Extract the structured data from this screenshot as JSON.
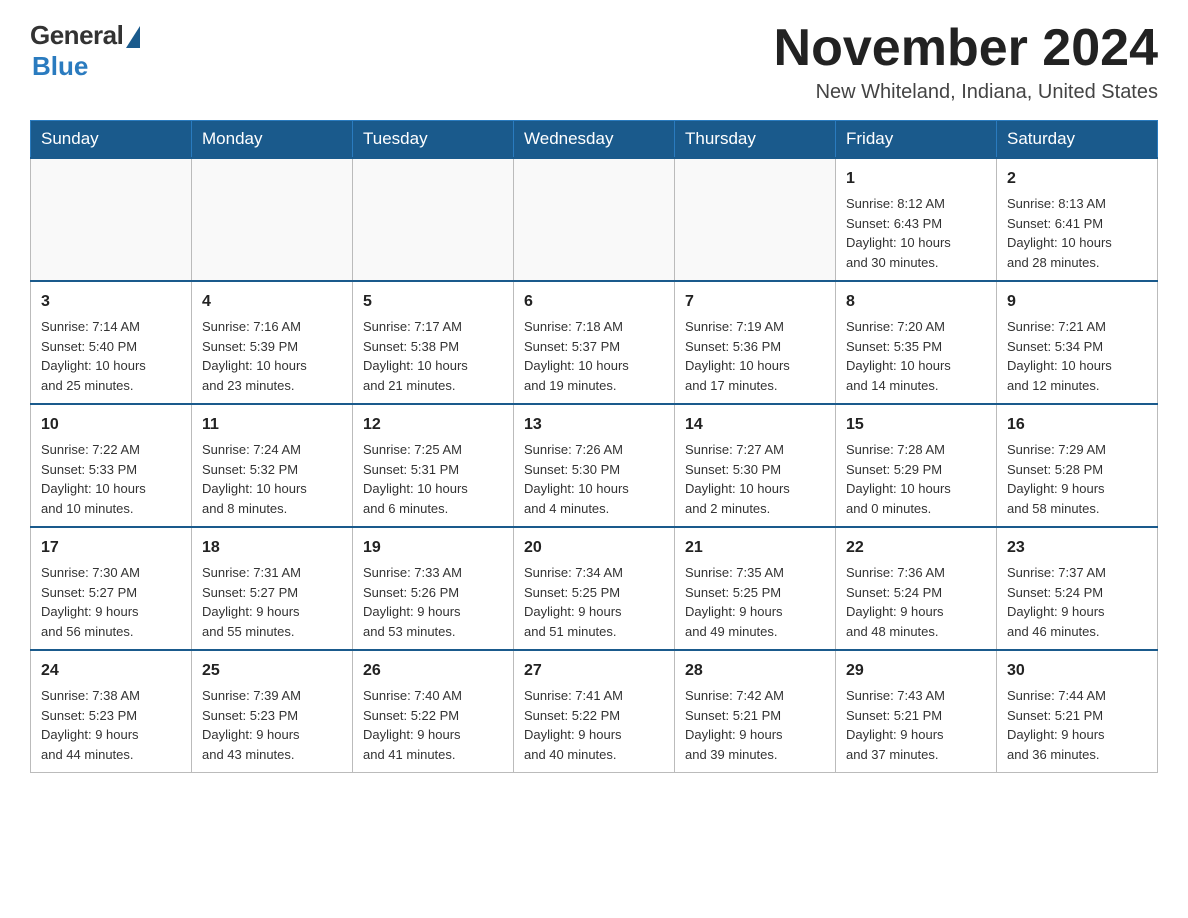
{
  "header": {
    "logo_general": "General",
    "logo_blue": "Blue",
    "month_title": "November 2024",
    "location": "New Whiteland, Indiana, United States"
  },
  "weekdays": [
    "Sunday",
    "Monday",
    "Tuesday",
    "Wednesday",
    "Thursday",
    "Friday",
    "Saturday"
  ],
  "weeks": [
    [
      {
        "day": "",
        "info": ""
      },
      {
        "day": "",
        "info": ""
      },
      {
        "day": "",
        "info": ""
      },
      {
        "day": "",
        "info": ""
      },
      {
        "day": "",
        "info": ""
      },
      {
        "day": "1",
        "info": "Sunrise: 8:12 AM\nSunset: 6:43 PM\nDaylight: 10 hours\nand 30 minutes."
      },
      {
        "day": "2",
        "info": "Sunrise: 8:13 AM\nSunset: 6:41 PM\nDaylight: 10 hours\nand 28 minutes."
      }
    ],
    [
      {
        "day": "3",
        "info": "Sunrise: 7:14 AM\nSunset: 5:40 PM\nDaylight: 10 hours\nand 25 minutes."
      },
      {
        "day": "4",
        "info": "Sunrise: 7:16 AM\nSunset: 5:39 PM\nDaylight: 10 hours\nand 23 minutes."
      },
      {
        "day": "5",
        "info": "Sunrise: 7:17 AM\nSunset: 5:38 PM\nDaylight: 10 hours\nand 21 minutes."
      },
      {
        "day": "6",
        "info": "Sunrise: 7:18 AM\nSunset: 5:37 PM\nDaylight: 10 hours\nand 19 minutes."
      },
      {
        "day": "7",
        "info": "Sunrise: 7:19 AM\nSunset: 5:36 PM\nDaylight: 10 hours\nand 17 minutes."
      },
      {
        "day": "8",
        "info": "Sunrise: 7:20 AM\nSunset: 5:35 PM\nDaylight: 10 hours\nand 14 minutes."
      },
      {
        "day": "9",
        "info": "Sunrise: 7:21 AM\nSunset: 5:34 PM\nDaylight: 10 hours\nand 12 minutes."
      }
    ],
    [
      {
        "day": "10",
        "info": "Sunrise: 7:22 AM\nSunset: 5:33 PM\nDaylight: 10 hours\nand 10 minutes."
      },
      {
        "day": "11",
        "info": "Sunrise: 7:24 AM\nSunset: 5:32 PM\nDaylight: 10 hours\nand 8 minutes."
      },
      {
        "day": "12",
        "info": "Sunrise: 7:25 AM\nSunset: 5:31 PM\nDaylight: 10 hours\nand 6 minutes."
      },
      {
        "day": "13",
        "info": "Sunrise: 7:26 AM\nSunset: 5:30 PM\nDaylight: 10 hours\nand 4 minutes."
      },
      {
        "day": "14",
        "info": "Sunrise: 7:27 AM\nSunset: 5:30 PM\nDaylight: 10 hours\nand 2 minutes."
      },
      {
        "day": "15",
        "info": "Sunrise: 7:28 AM\nSunset: 5:29 PM\nDaylight: 10 hours\nand 0 minutes."
      },
      {
        "day": "16",
        "info": "Sunrise: 7:29 AM\nSunset: 5:28 PM\nDaylight: 9 hours\nand 58 minutes."
      }
    ],
    [
      {
        "day": "17",
        "info": "Sunrise: 7:30 AM\nSunset: 5:27 PM\nDaylight: 9 hours\nand 56 minutes."
      },
      {
        "day": "18",
        "info": "Sunrise: 7:31 AM\nSunset: 5:27 PM\nDaylight: 9 hours\nand 55 minutes."
      },
      {
        "day": "19",
        "info": "Sunrise: 7:33 AM\nSunset: 5:26 PM\nDaylight: 9 hours\nand 53 minutes."
      },
      {
        "day": "20",
        "info": "Sunrise: 7:34 AM\nSunset: 5:25 PM\nDaylight: 9 hours\nand 51 minutes."
      },
      {
        "day": "21",
        "info": "Sunrise: 7:35 AM\nSunset: 5:25 PM\nDaylight: 9 hours\nand 49 minutes."
      },
      {
        "day": "22",
        "info": "Sunrise: 7:36 AM\nSunset: 5:24 PM\nDaylight: 9 hours\nand 48 minutes."
      },
      {
        "day": "23",
        "info": "Sunrise: 7:37 AM\nSunset: 5:24 PM\nDaylight: 9 hours\nand 46 minutes."
      }
    ],
    [
      {
        "day": "24",
        "info": "Sunrise: 7:38 AM\nSunset: 5:23 PM\nDaylight: 9 hours\nand 44 minutes."
      },
      {
        "day": "25",
        "info": "Sunrise: 7:39 AM\nSunset: 5:23 PM\nDaylight: 9 hours\nand 43 minutes."
      },
      {
        "day": "26",
        "info": "Sunrise: 7:40 AM\nSunset: 5:22 PM\nDaylight: 9 hours\nand 41 minutes."
      },
      {
        "day": "27",
        "info": "Sunrise: 7:41 AM\nSunset: 5:22 PM\nDaylight: 9 hours\nand 40 minutes."
      },
      {
        "day": "28",
        "info": "Sunrise: 7:42 AM\nSunset: 5:21 PM\nDaylight: 9 hours\nand 39 minutes."
      },
      {
        "day": "29",
        "info": "Sunrise: 7:43 AM\nSunset: 5:21 PM\nDaylight: 9 hours\nand 37 minutes."
      },
      {
        "day": "30",
        "info": "Sunrise: 7:44 AM\nSunset: 5:21 PM\nDaylight: 9 hours\nand 36 minutes."
      }
    ]
  ]
}
